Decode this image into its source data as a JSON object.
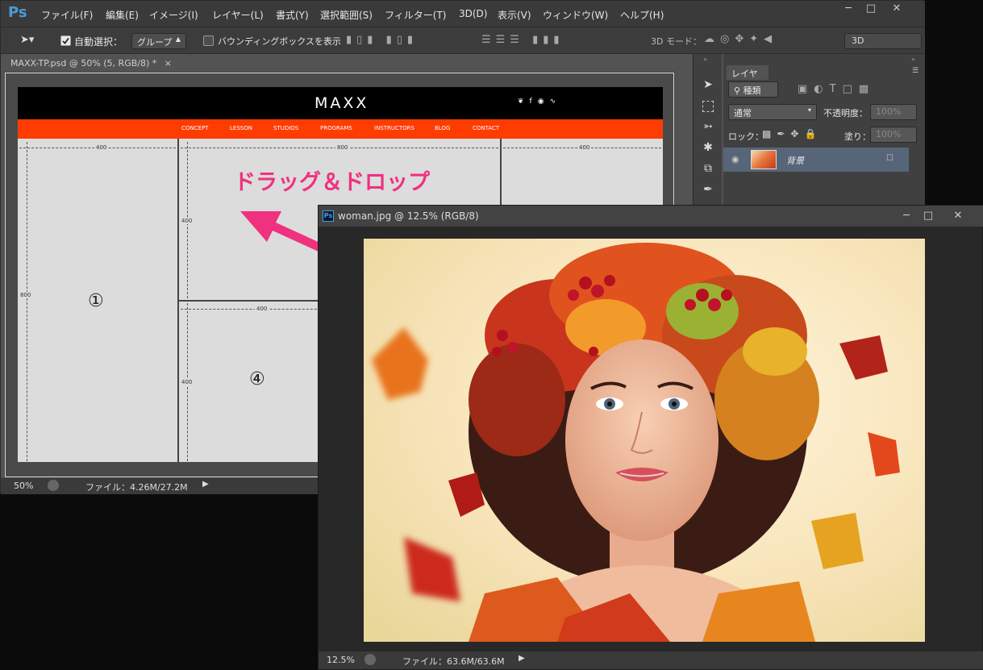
{
  "menubar": {
    "logo": "Ps",
    "items": [
      "ファイル(F)",
      "編集(E)",
      "イメージ(I)",
      "レイヤー(L)",
      "書式(Y)",
      "選択範囲(S)",
      "フィルター(T)",
      "3D(D)",
      "表示(V)",
      "ウィンドウ(W)",
      "ヘルプ(H)"
    ]
  },
  "options": {
    "auto_select_label": "自動選択：",
    "auto_select_value": "グループ",
    "bounding_box_label": "バウンディングボックスを表示",
    "mode_3d_label": "3D モード：",
    "workspace_3d": "3D"
  },
  "document": {
    "tab_title": "MAXX-TP.psd @ 50% (5, RGB/8) *",
    "zoom": "50%",
    "file_info": "ファイル：4.26M/27.2M"
  },
  "mockup": {
    "logo": "MAXX",
    "nav": [
      "CONCEPT",
      "LESSON",
      "STUDIOS",
      "PROGRAMS",
      "INSTRUCTORS",
      "BLOG",
      "CONTACT"
    ],
    "dims": {
      "w400": "400",
      "w800": "800",
      "h800": "800",
      "h400": "400"
    },
    "block1": "①",
    "block4": "④"
  },
  "annotation": {
    "text": "ドラッグ＆ドロップ",
    "color": "#f0317f"
  },
  "layers_panel": {
    "tab_label": "レイヤー",
    "filter_kind": "種類",
    "blend_mode": "通常",
    "opacity_label": "不透明度：",
    "opacity_value": "100%",
    "lock_label": "ロック：",
    "fill_label": "塗り：",
    "fill_value": "100%",
    "layer_name": "背景"
  },
  "image_window": {
    "title": "woman.jpg @ 12.5% (RGB/8)",
    "zoom": "12.5%",
    "file_info": "ファイル：63.6M/63.6M"
  },
  "colors": {
    "accent_orange": "#ff3c00",
    "ps_blue": "#4a9ad8"
  }
}
